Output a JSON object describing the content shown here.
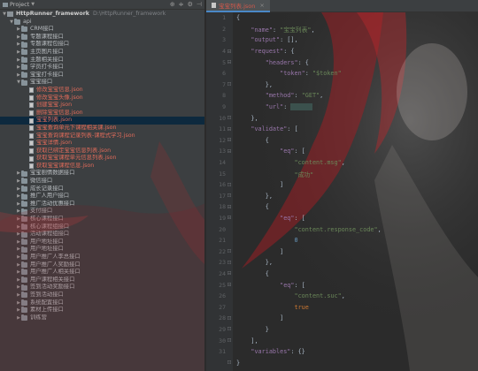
{
  "project_panel": {
    "title": "Project",
    "root": {
      "name": "HttpRunner_framework",
      "path": "D:\\HttpRunner_framework"
    },
    "tree": [
      {
        "label": "api",
        "depth": 1,
        "type": "folder",
        "expanded": true
      },
      {
        "label": "CRM接口",
        "depth": 2,
        "type": "folder"
      },
      {
        "label": "专题课程接口",
        "depth": 2,
        "type": "folder"
      },
      {
        "label": "专题课程包接口",
        "depth": 2,
        "type": "folder"
      },
      {
        "label": "主页图片接口",
        "depth": 2,
        "type": "folder"
      },
      {
        "label": "主题相关接口",
        "depth": 2,
        "type": "folder"
      },
      {
        "label": "学员打卡接口",
        "depth": 2,
        "type": "folder"
      },
      {
        "label": "宝宝打卡接口",
        "depth": 2,
        "type": "folder"
      },
      {
        "label": "宝宝接口",
        "depth": 2,
        "type": "folder",
        "expanded": true
      },
      {
        "label": "修改宝宝信息.json",
        "depth": 3,
        "type": "file"
      },
      {
        "label": "修改宝宝头像.json",
        "depth": 3,
        "type": "file"
      },
      {
        "label": "创建宝宝.json",
        "depth": 3,
        "type": "file"
      },
      {
        "label": "删除宝宝信息.json",
        "depth": 3,
        "type": "file"
      },
      {
        "label": "宝宝列表.json",
        "depth": 3,
        "type": "file",
        "selected": true
      },
      {
        "label": "宝宝查询单元下课程相关课.json",
        "depth": 3,
        "type": "file"
      },
      {
        "label": "宝宝查询课程记录列表-课程式学习.json",
        "depth": 3,
        "type": "file"
      },
      {
        "label": "宝宝详情.json",
        "depth": 3,
        "type": "file"
      },
      {
        "label": "获取已绑定宝宝信息列表.json",
        "depth": 3,
        "type": "file"
      },
      {
        "label": "获取宝宝课程单元信息列表.json",
        "depth": 3,
        "type": "file"
      },
      {
        "label": "获取宝宝课程信息.json",
        "depth": 3,
        "type": "file"
      },
      {
        "label": "宝宝剧情数据接口",
        "depth": 2,
        "type": "folder"
      },
      {
        "label": "微信接口",
        "depth": 2,
        "type": "folder"
      },
      {
        "label": "成长记录接口",
        "depth": 2,
        "type": "folder"
      },
      {
        "label": "推广人用户接口",
        "depth": 2,
        "type": "folder"
      },
      {
        "label": "推广活动优惠接口",
        "depth": 2,
        "type": "folder"
      },
      {
        "label": "支付接口",
        "depth": 2,
        "type": "folder"
      },
      {
        "label": "核心课程接口",
        "depth": 2,
        "type": "folder"
      },
      {
        "label": "核心课程组接口",
        "depth": 2,
        "type": "folder"
      },
      {
        "label": "活动课程组接口",
        "depth": 2,
        "type": "folder"
      },
      {
        "label": "用户地址接口",
        "depth": 2,
        "type": "folder"
      },
      {
        "label": "用户地址接口",
        "depth": 2,
        "type": "folder"
      },
      {
        "label": "用户推广人李总接口",
        "depth": 2,
        "type": "folder"
      },
      {
        "label": "用户推广人奖励接口",
        "depth": 2,
        "type": "folder"
      },
      {
        "label": "用户推广人相关接口",
        "depth": 2,
        "type": "folder"
      },
      {
        "label": "用户课程相关接口",
        "depth": 2,
        "type": "folder"
      },
      {
        "label": "签到活动奖励接口",
        "depth": 2,
        "type": "folder"
      },
      {
        "label": "签到活动接口",
        "depth": 2,
        "type": "folder"
      },
      {
        "label": "系统配置接口",
        "depth": 2,
        "type": "folder"
      },
      {
        "label": "素材上传接口",
        "depth": 2,
        "type": "folder"
      },
      {
        "label": "训练营",
        "depth": 2,
        "type": "folder"
      }
    ]
  },
  "editor": {
    "tab": {
      "name": "宝宝列表.json"
    },
    "line_count": 31,
    "code": {
      "name_key": "\"name\"",
      "name_val": "\"宝宝列表\"",
      "output_key": "\"output\"",
      "request_key": "\"request\"",
      "headers_key": "\"headers\"",
      "token_key": "\"token\"",
      "token_val": "\"$token\"",
      "method_key": "\"method\"",
      "method_val": "\"GET\"",
      "url_key": "\"url\"",
      "validate_key": "\"validate\"",
      "eq_key": "\"eq\"",
      "content_msg": "\"content.msg\"",
      "success": "\"成功\"",
      "response_code": "\"content.response_code\"",
      "zero": "0",
      "content_suc": "\"content.suc\"",
      "true_val": "true",
      "variables_key": "\"variables\""
    }
  },
  "colors": {
    "accent": "#4a88c7",
    "file_text": "#e06b5a",
    "selection": "#0d293e",
    "string": "#6a8759",
    "key": "#9876aa",
    "number": "#6897bb"
  }
}
